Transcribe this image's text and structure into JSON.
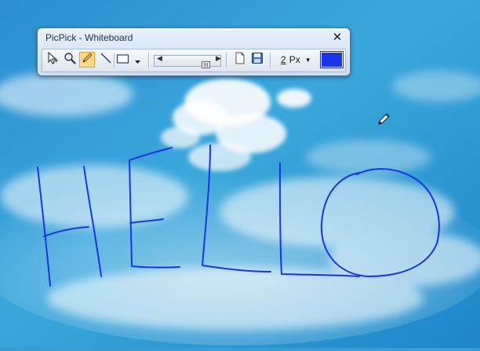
{
  "window": {
    "title": "PicPick - Whiteboard",
    "close_glyph": "✕"
  },
  "toolbar": {
    "tools": [
      {
        "name": "select-arrow-icon",
        "active": false
      },
      {
        "name": "zoom-icon",
        "active": false
      },
      {
        "name": "pencil-icon",
        "active": true
      },
      {
        "name": "line-icon",
        "active": false
      },
      {
        "name": "rectangle-icon",
        "active": false
      }
    ],
    "pen_size_value": "2",
    "pen_size_unit": "Px",
    "pen_color": "#1a35e6"
  },
  "colors": {
    "accent": "#ffd889",
    "stroke": "#1a35e6"
  },
  "cursor": "pencil-cursor-icon"
}
